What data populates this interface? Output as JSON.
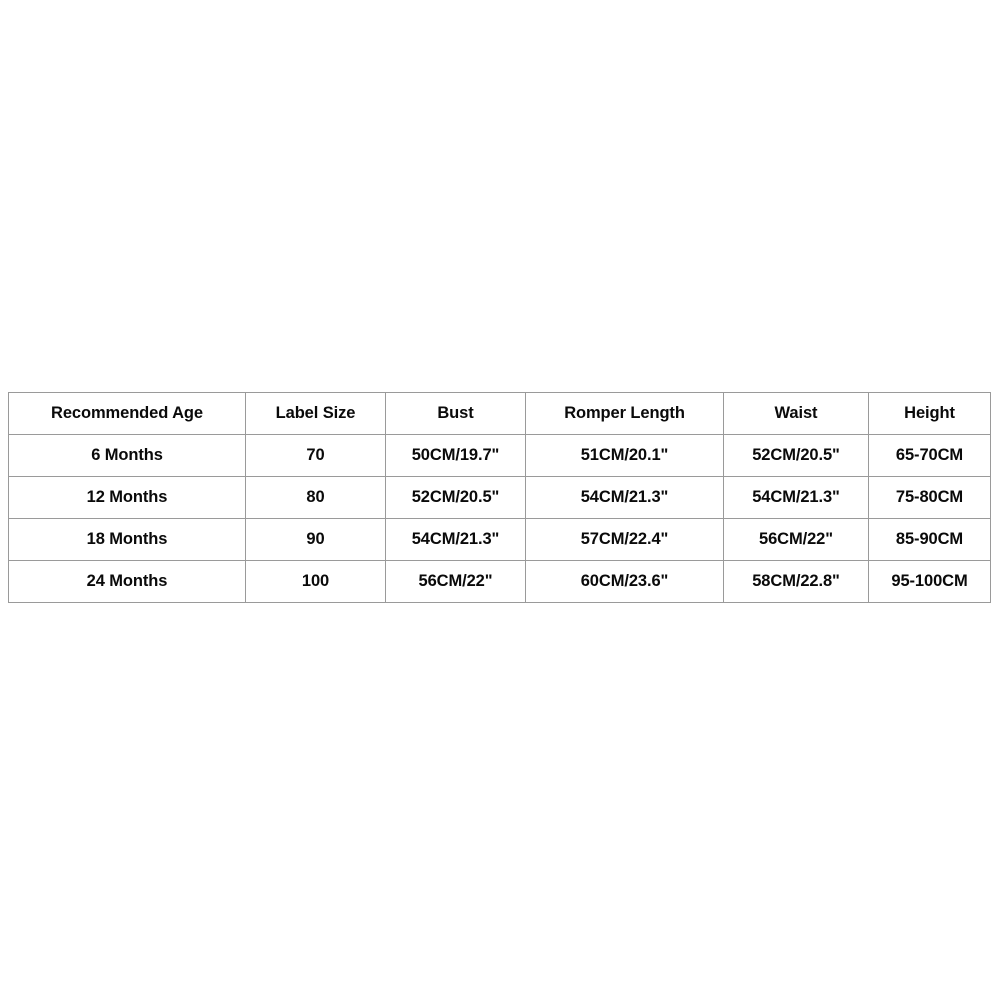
{
  "table": {
    "headers": [
      "Recommended Age",
      "Label Size",
      "Bust",
      "Romper Length",
      "Waist",
      "Height"
    ],
    "rows": [
      {
        "age": "6 Months",
        "label_size": "70",
        "bust": "50CM/19.7\"",
        "romper_length": "51CM/20.1\"",
        "waist": "52CM/20.5\"",
        "height": "65-70CM"
      },
      {
        "age": "12 Months",
        "label_size": "80",
        "bust": "52CM/20.5\"",
        "romper_length": "54CM/21.3\"",
        "waist": "54CM/21.3\"",
        "height": "75-80CM"
      },
      {
        "age": "18 Months",
        "label_size": "90",
        "bust": "54CM/21.3\"",
        "romper_length": "57CM/22.4\"",
        "waist": "56CM/22\"",
        "height": "85-90CM"
      },
      {
        "age": "24 Months",
        "label_size": "100",
        "bust": "56CM/22\"",
        "romper_length": "60CM/23.6\"",
        "waist": "58CM/22.8\"",
        "height": "95-100CM"
      }
    ]
  },
  "colors": {
    "border": "#9a9a9a",
    "text": "#0a0a0a",
    "background": "#ffffff"
  }
}
